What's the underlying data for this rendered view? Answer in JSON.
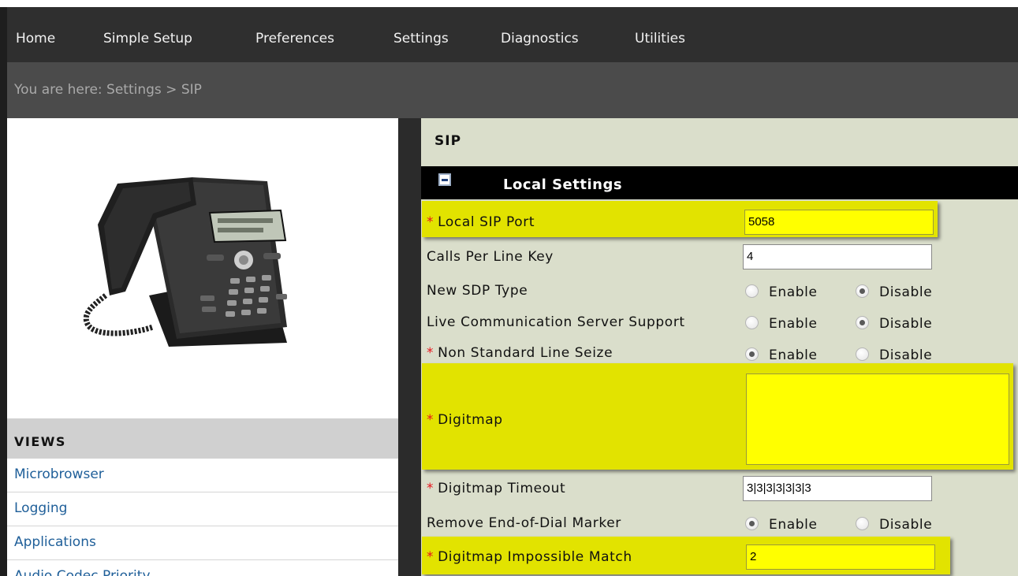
{
  "nav": {
    "items": [
      {
        "label": "Home"
      },
      {
        "label": "Simple Setup"
      },
      {
        "label": "Preferences"
      },
      {
        "label": "Settings"
      },
      {
        "label": "Diagnostics"
      },
      {
        "label": "Utilities"
      }
    ]
  },
  "breadcrumb": "You are here: Settings > SIP",
  "views": {
    "title": "VIEWS",
    "items": [
      {
        "label": "Microbrowser"
      },
      {
        "label": "Logging"
      },
      {
        "label": "Applications"
      },
      {
        "label": "Audio Codec Priority"
      }
    ]
  },
  "main": {
    "title": "SIP",
    "section_title": "Local Settings",
    "required_marker": "*",
    "fields": {
      "local_sip_port": {
        "label": "Local SIP Port",
        "value": "5058"
      },
      "calls_per_line_key": {
        "label": "Calls Per Line Key",
        "value": "4"
      },
      "new_sdp_type": {
        "label": "New SDP Type"
      },
      "lcs_support": {
        "label": "Live Communication Server Support"
      },
      "non_standard_line_seize": {
        "label": "Non Standard Line Seize"
      },
      "digitmap": {
        "label": "Digitmap",
        "value": ""
      },
      "digitmap_timeout": {
        "label": "Digitmap Timeout",
        "value": "3|3|3|3|3|3|3"
      },
      "remove_eod_marker": {
        "label": "Remove End-of-Dial Marker"
      },
      "digitmap_impossible_match": {
        "label": "Digitmap Impossible Match",
        "value": "2"
      }
    },
    "radio": {
      "enable": "Enable",
      "disable": "Disable"
    }
  },
  "colors": {
    "highlight": "#e2e300",
    "field_highlight": "#ffff00",
    "required": "#e8131b",
    "link": "#1f5f99",
    "panel": "#dadecb"
  }
}
